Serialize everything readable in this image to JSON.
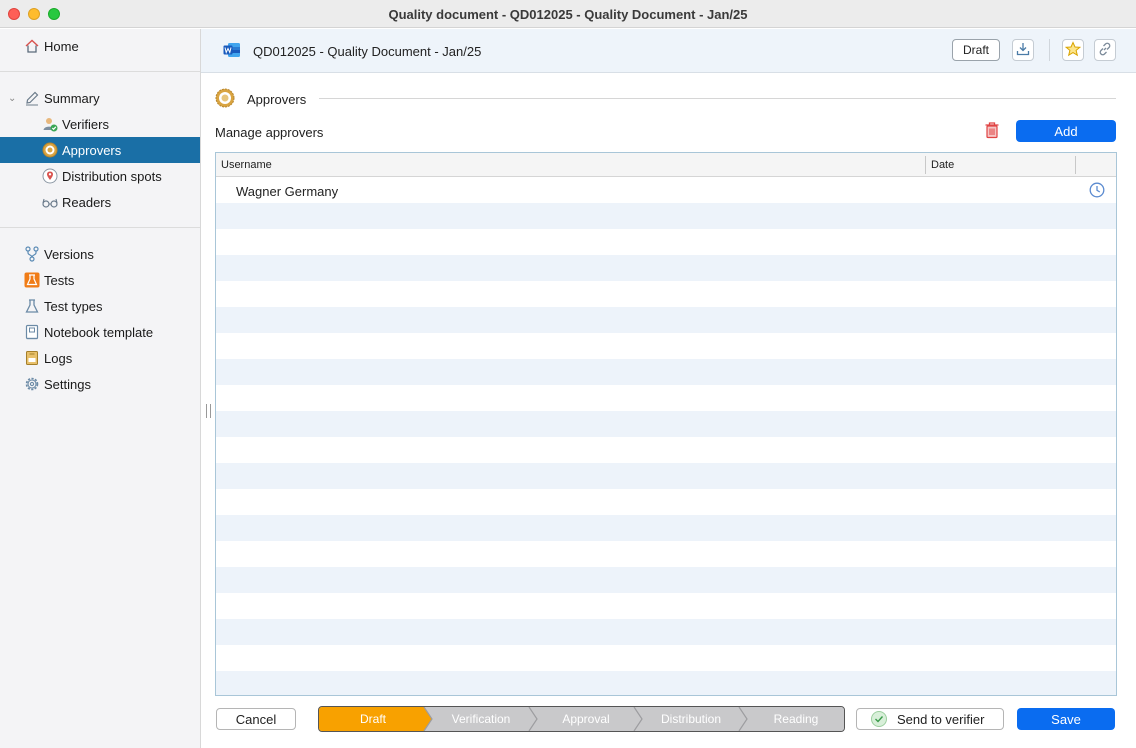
{
  "window": {
    "title": "Quality document - QD012025 - Quality Document - Jan/25"
  },
  "sidebar": {
    "home": "Home",
    "summary": "Summary",
    "summary_children": [
      "Verifiers",
      "Approvers",
      "Distribution spots",
      "Readers"
    ],
    "items": [
      "Versions",
      "Tests",
      "Test types",
      "Notebook template",
      "Logs",
      "Settings"
    ],
    "selected": "Approvers"
  },
  "header": {
    "doc_title": "QD012025 - Quality Document - Jan/25",
    "status_badge": "Draft"
  },
  "section": {
    "title": "Approvers",
    "manage_label": "Manage approvers",
    "add_label": "Add"
  },
  "table": {
    "columns": [
      "Username",
      "Date",
      ""
    ],
    "rows": [
      {
        "username": "Wagner Germany",
        "date": ""
      }
    ]
  },
  "footer": {
    "cancel": "Cancel",
    "workflow_steps": [
      "Draft",
      "Verification",
      "Approval",
      "Distribution",
      "Reading"
    ],
    "active_step": "Draft",
    "send_to_verifier": "Send to verifier",
    "save": "Save"
  },
  "colors": {
    "accent": "#0a6cf0",
    "sidebar_selected": "#1a6fa6",
    "workflow_active": "#f8a100",
    "workflow_inactive": "#c9c9cb"
  }
}
